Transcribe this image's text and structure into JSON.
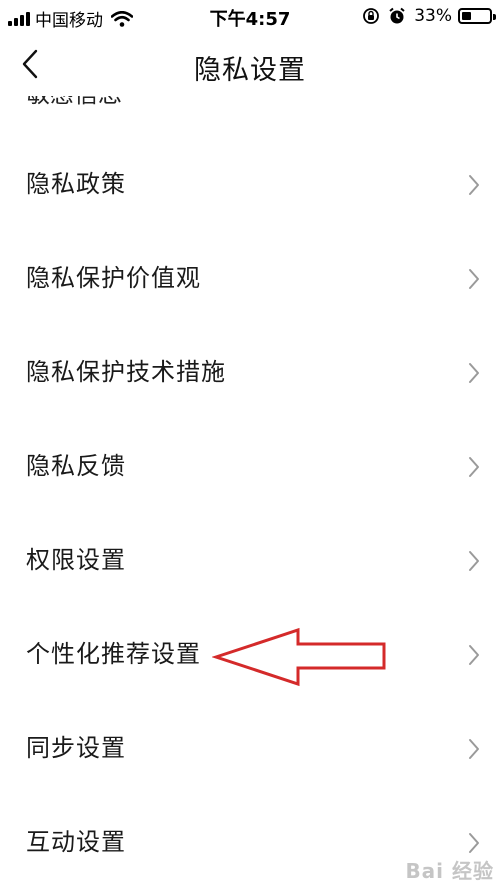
{
  "status_bar": {
    "carrier": "中国移动",
    "time": "下午4:57",
    "battery_percent": "33%",
    "battery_level": 0.33,
    "icons": [
      "signal-icon",
      "wifi-icon",
      "rotation-lock-icon",
      "alarm-icon",
      "battery-icon"
    ]
  },
  "nav": {
    "title": "隐私设置",
    "back_icon": "chevron-left-icon"
  },
  "partial_item": "敏感信息",
  "items": [
    {
      "label": "隐私政策"
    },
    {
      "label": "隐私保护价值观"
    },
    {
      "label": "隐私保护技术措施"
    },
    {
      "label": "隐私反馈"
    },
    {
      "label": "权限设置"
    },
    {
      "label": "个性化推荐设置"
    },
    {
      "label": "同步设置"
    },
    {
      "label": "互动设置"
    }
  ],
  "annotation": {
    "type": "arrow-left",
    "color": "#d42a2a",
    "points_to": "个性化推荐设置"
  },
  "watermark": "Bai 经验",
  "colors": {
    "text": "#1a1a1a",
    "chevron": "#9a9a9a",
    "background": "#ffffff"
  }
}
